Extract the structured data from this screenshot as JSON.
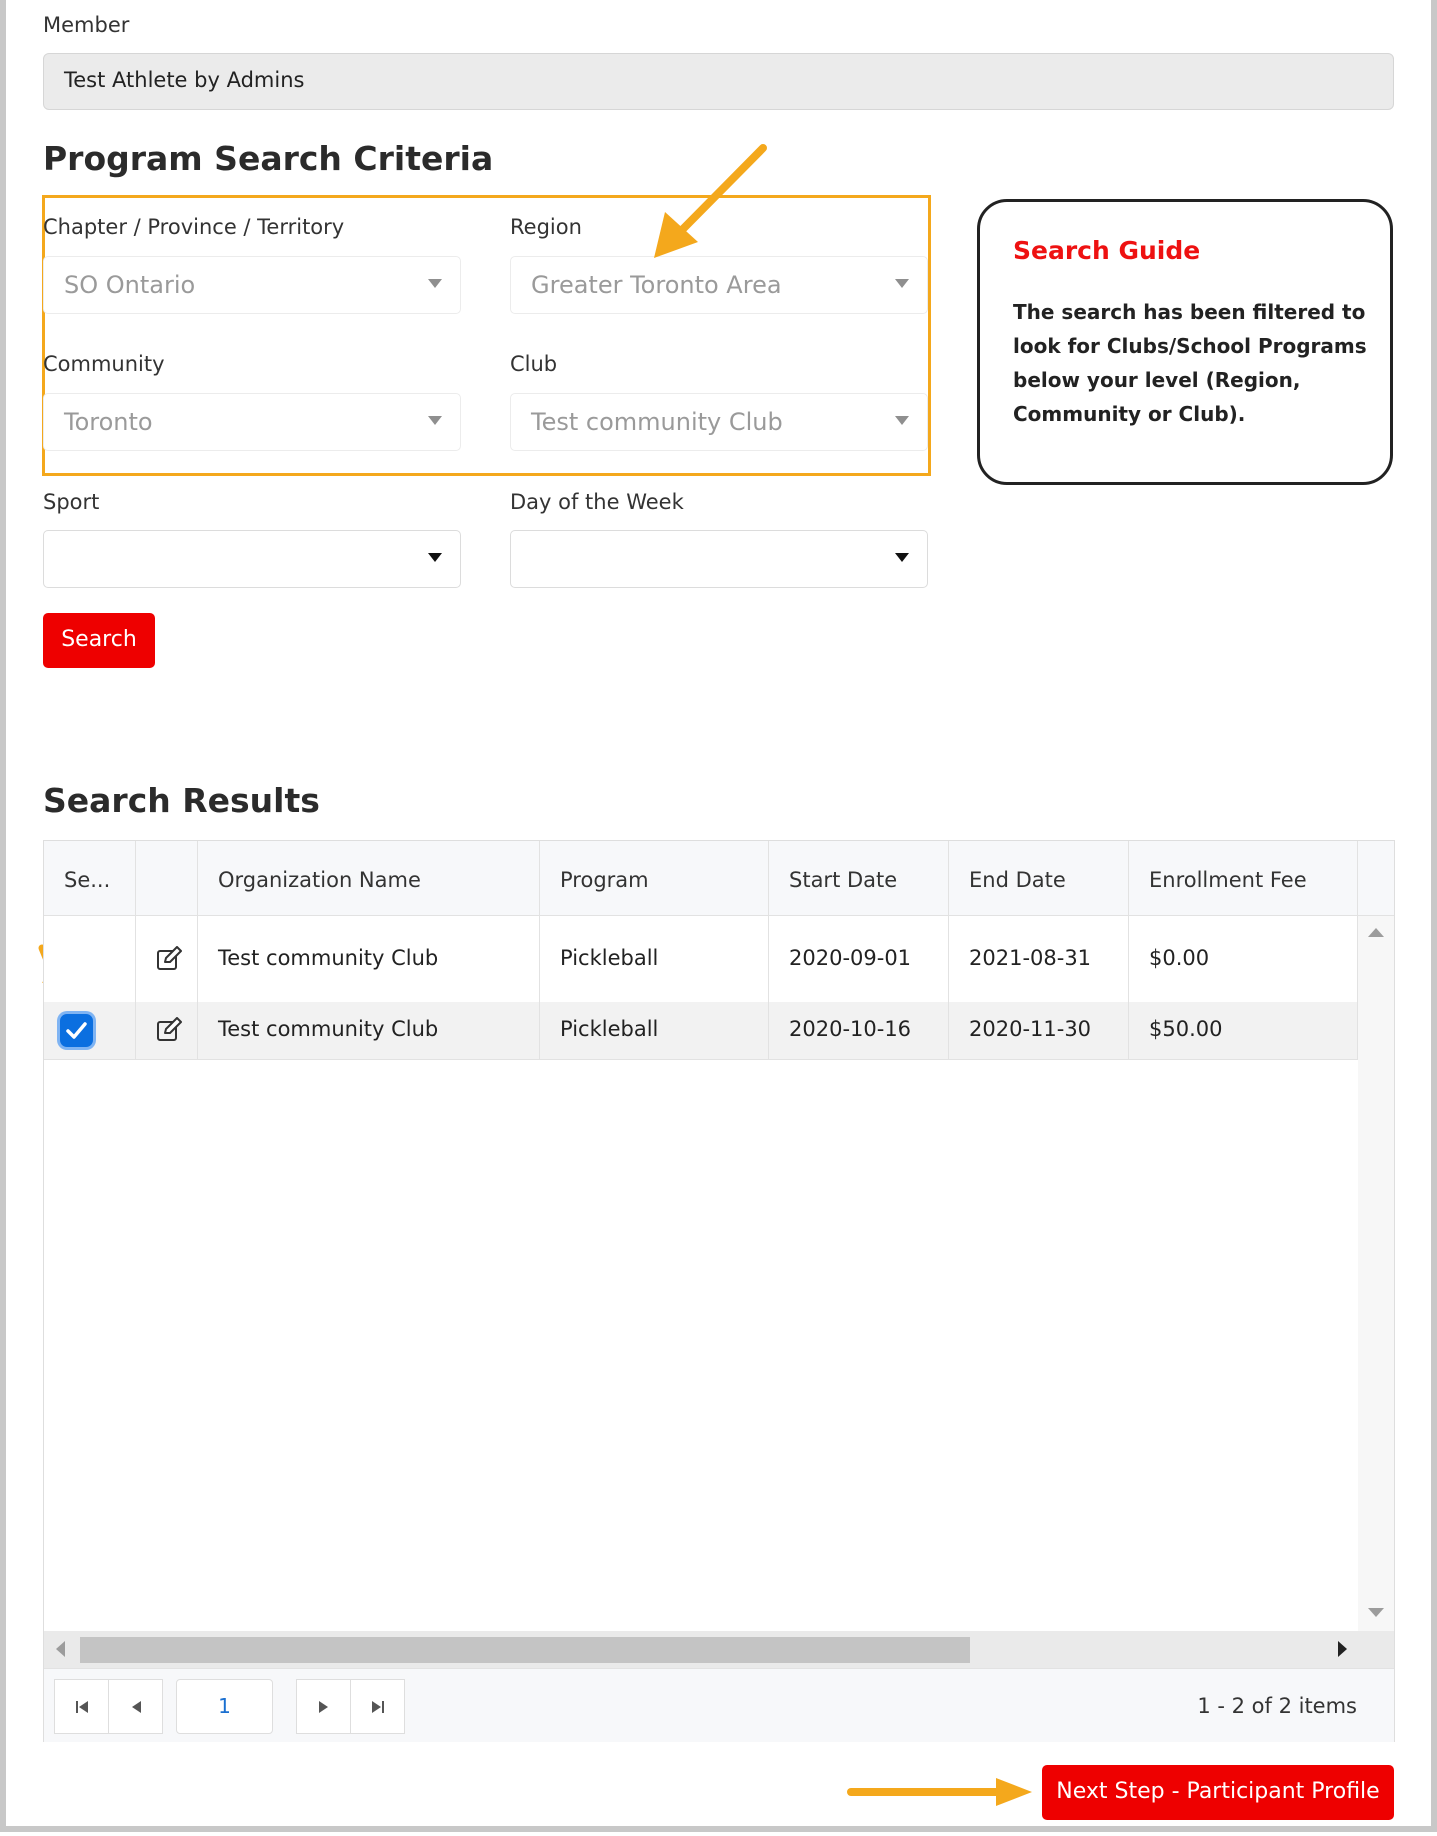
{
  "member": {
    "label": "Member",
    "value": "Test Athlete by Admins"
  },
  "criteria": {
    "heading": "Program Search Criteria",
    "chapter": {
      "label": "Chapter / Province / Territory",
      "value": "SO Ontario"
    },
    "region": {
      "label": "Region",
      "value": "Greater Toronto Area"
    },
    "community": {
      "label": "Community",
      "value": "Toronto"
    },
    "club": {
      "label": "Club",
      "value": "Test community Club"
    },
    "sport": {
      "label": "Sport",
      "value": ""
    },
    "day": {
      "label": "Day of the Week",
      "value": ""
    },
    "search_label": "Search"
  },
  "guide": {
    "title": "Search Guide",
    "text": "The search has been filtered to look for Clubs/School Programs below your level (Region, Community or Club)."
  },
  "results": {
    "heading": "Search Results",
    "columns": [
      "Se...",
      "",
      "Organization Name",
      "Program",
      "Start Date",
      "End Date",
      "Enrollment Fee"
    ],
    "rows": [
      {
        "selected": false,
        "organization": "Test community Club",
        "program": "Pickleball",
        "start": "2020-09-01",
        "end": "2021-08-31",
        "fee": "$0.00"
      },
      {
        "selected": true,
        "organization": "Test community Club",
        "program": "Pickleball",
        "start": "2020-10-16",
        "end": "2020-11-30",
        "fee": "$50.00"
      }
    ],
    "pager": {
      "page": "1",
      "summary": "1 - 2 of 2 items"
    }
  },
  "next_label": "Next Step - Participant Profile",
  "colors": {
    "accent": "#ee0000",
    "annotation": "#f4a81c",
    "checkbox": "#0b6fe0"
  }
}
